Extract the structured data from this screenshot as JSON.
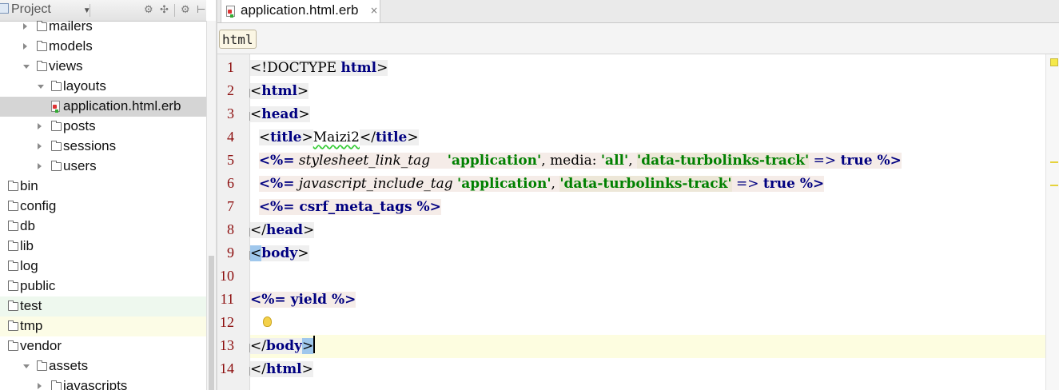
{
  "project_panel": {
    "title": "Project",
    "tools": [
      "⚙",
      "✣",
      "⚙",
      "⊢"
    ],
    "tree": [
      {
        "label": "mailers",
        "depth": 1,
        "arrow": "right",
        "icon": "folder",
        "state": ""
      },
      {
        "label": "models",
        "depth": 1,
        "arrow": "right",
        "icon": "folder",
        "state": ""
      },
      {
        "label": "views",
        "depth": 1,
        "arrow": "down",
        "icon": "folder",
        "state": ""
      },
      {
        "label": "layouts",
        "depth": 2,
        "arrow": "down",
        "icon": "folder",
        "state": ""
      },
      {
        "label": "application.html.erb",
        "depth": 3,
        "arrow": "",
        "icon": "erb-file",
        "state": "selected"
      },
      {
        "label": "posts",
        "depth": 2,
        "arrow": "right",
        "icon": "folder",
        "state": ""
      },
      {
        "label": "sessions",
        "depth": 2,
        "arrow": "right",
        "icon": "folder",
        "state": ""
      },
      {
        "label": "users",
        "depth": 2,
        "arrow": "right",
        "icon": "folder",
        "state": ""
      },
      {
        "label": "bin",
        "depth": 0,
        "arrow": "",
        "icon": "folder",
        "state": ""
      },
      {
        "label": "config",
        "depth": 0,
        "arrow": "",
        "icon": "folder",
        "state": ""
      },
      {
        "label": "db",
        "depth": 0,
        "arrow": "",
        "icon": "folder",
        "state": ""
      },
      {
        "label": "lib",
        "depth": 0,
        "arrow": "",
        "icon": "folder",
        "state": ""
      },
      {
        "label": "log",
        "depth": 0,
        "arrow": "",
        "icon": "folder",
        "state": ""
      },
      {
        "label": "public",
        "depth": 0,
        "arrow": "",
        "icon": "folder",
        "state": ""
      },
      {
        "label": "test",
        "depth": 0,
        "arrow": "",
        "icon": "folder",
        "state": "green"
      },
      {
        "label": "tmp",
        "depth": 0,
        "arrow": "",
        "icon": "folder",
        "state": "yellow"
      },
      {
        "label": "vendor",
        "depth": 0,
        "arrow": "",
        "icon": "folder",
        "state": ""
      },
      {
        "label": "assets",
        "depth": 1,
        "arrow": "down",
        "icon": "folder",
        "state": ""
      },
      {
        "label": "javascripts",
        "depth": 2,
        "arrow": "right",
        "icon": "folder",
        "state": ""
      }
    ]
  },
  "editor": {
    "tab_label": "application.html.erb",
    "tab_close": "×",
    "breadcrumb": "html",
    "line_numbers": [
      "1",
      "2",
      "3",
      "4",
      "5",
      "6",
      "7",
      "8",
      "9",
      "10",
      "11",
      "12",
      "13",
      "14"
    ],
    "lines": {
      "l1_open": "<!DOCTYPE ",
      "l1_kw": "html",
      "l1_close": ">",
      "l2_open": "<",
      "l2_name": "html",
      "l2_close": ">",
      "l3_open": "<",
      "l3_name": "head",
      "l3_close": ">",
      "l4_indent": "  ",
      "l4_open": "<",
      "l4_name": "title",
      "l4_mid": ">",
      "l4_text": "Maizi2",
      "l4_open2": "</",
      "l4_name2": "title",
      "l4_close": ">",
      "l5_indent": "  ",
      "l5_erb_open": "<%=",
      "l5_method": " stylesheet_link_tag    ",
      "l5_str1": "'application'",
      "l5_comma1": ", ",
      "l5_sym": "media: ",
      "l5_str2": "'all'",
      "l5_comma2": ", ",
      "l5_str3": "'data-turbolinks-track'",
      "l5_arrow": " => ",
      "l5_kw": "true",
      "l5_erb_close": " %>",
      "l6_indent": "  ",
      "l6_erb_open": "<%=",
      "l6_method": " javascript_include_tag ",
      "l6_str1": "'application'",
      "l6_comma1": ", ",
      "l6_str2": "'data-turbolinks-track'",
      "l6_arrow": " => ",
      "l6_kw": "true",
      "l6_erb_close": " %>",
      "l7_indent": "  ",
      "l7_erb_open": "<%=",
      "l7_body": " csrf_meta_tags ",
      "l7_erb_close": "%>",
      "l8_open": "</",
      "l8_name": "head",
      "l8_close": ">",
      "l9_open": "<",
      "l9_name": "body",
      "l9_close": ">",
      "l11_erb_open": "<%=",
      "l11_body": " yield ",
      "l11_erb_close": "%>",
      "l13_open": "</",
      "l13_name": "body",
      "l13_close": ">",
      "l14_open": "</",
      "l14_name": "html",
      "l14_close": ">"
    },
    "current_line": 13
  },
  "colors": {
    "tag_name": "#000080",
    "string": "#008000",
    "line_number": "#8c0d0d",
    "current_line": "#fdfde0",
    "selected_row": "#d5d5d5"
  }
}
